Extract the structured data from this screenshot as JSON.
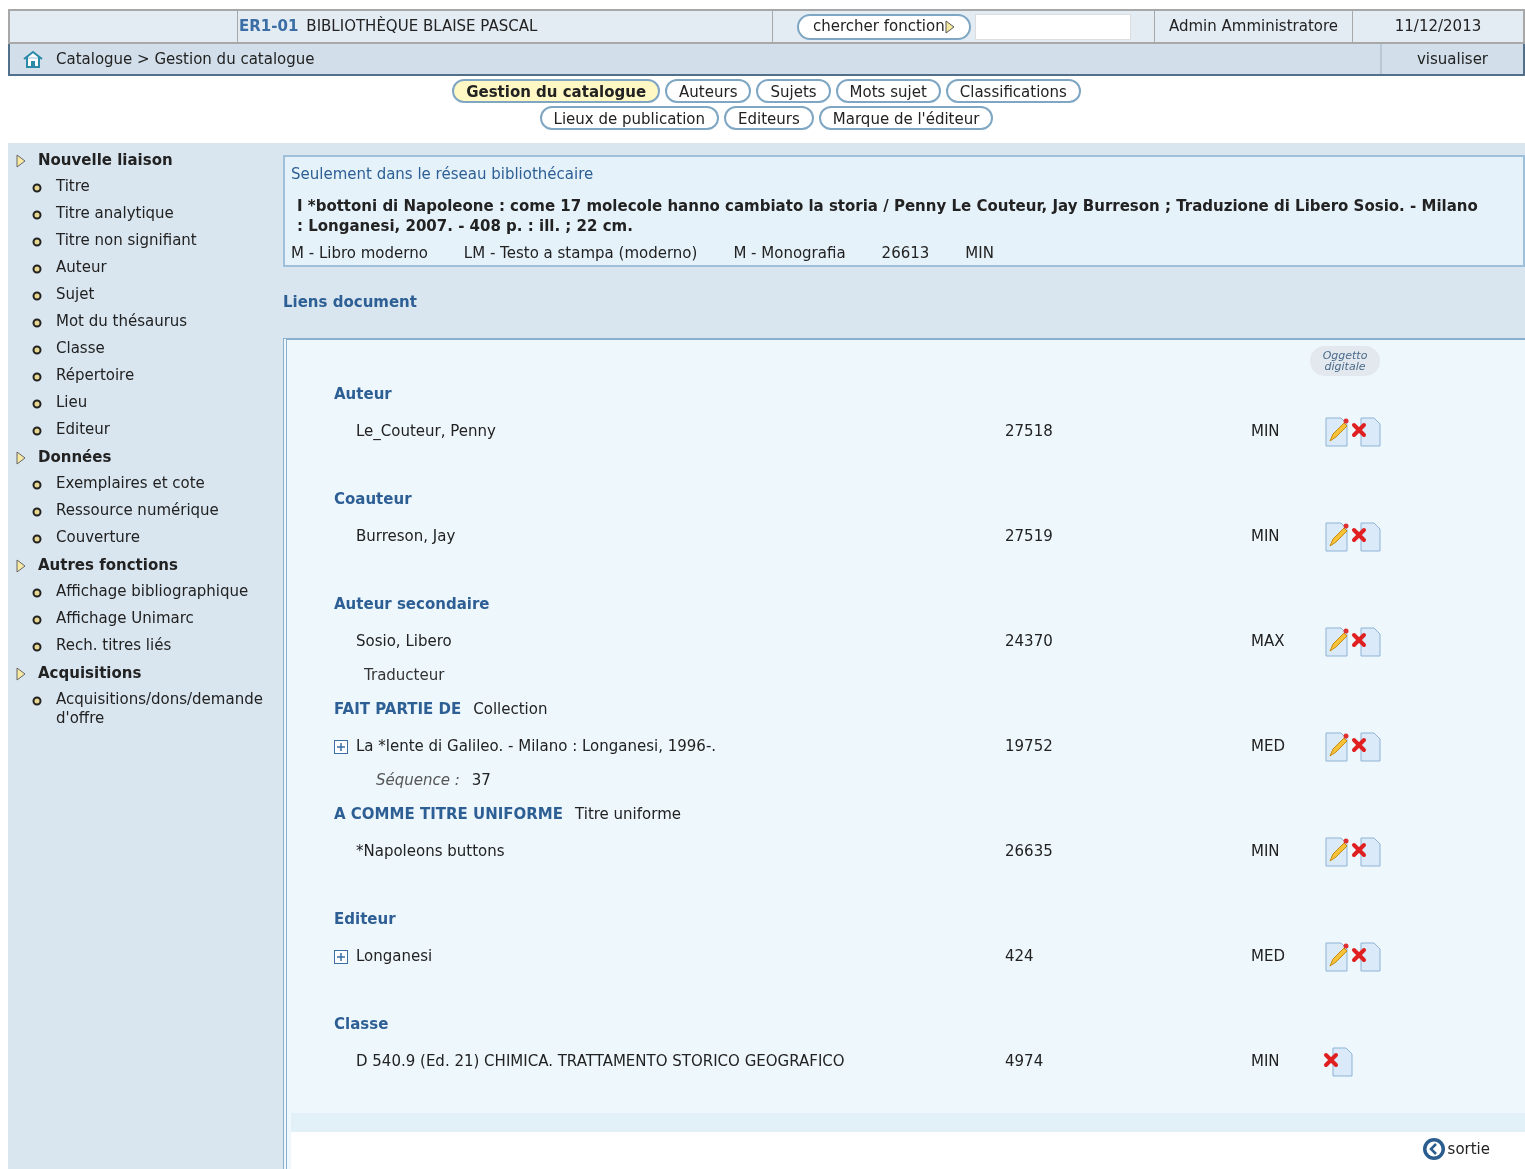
{
  "header": {
    "code": "ER1-01",
    "library": "BIBLIOTHÈQUE BLAISE PASCAL",
    "search_button": "chercher fonction",
    "user": "Admin Amministratore",
    "date": "11/12/2013"
  },
  "breadcrumb": {
    "path": "Catalogue > Gestion du catalogue",
    "view_link": "visualiser"
  },
  "tab_rows": [
    {
      "tabs": [
        {
          "label": "Gestion du catalogue",
          "selected": true
        },
        {
          "label": "Auteurs",
          "selected": false
        },
        {
          "label": "Sujets",
          "selected": false
        },
        {
          "label": "Mots sujet",
          "selected": false
        },
        {
          "label": "Classifications",
          "selected": false
        }
      ]
    },
    {
      "tabs": [
        {
          "label": "Lieux de publication",
          "selected": false
        },
        {
          "label": "Editeurs",
          "selected": false
        },
        {
          "label": "Marque de l'éditeur",
          "selected": false
        }
      ]
    }
  ],
  "sidebar": {
    "groups": [
      {
        "title": "Nouvelle liaison",
        "items": [
          "Titre",
          "Titre analytique",
          "Titre non signifiant",
          "Auteur",
          "Sujet",
          "Mot du thésaurus",
          "Classe",
          "Répertoire",
          "Lieu",
          "Editeur"
        ]
      },
      {
        "title": "Données",
        "items": [
          "Exemplaires et cote",
          "Ressource numérique",
          "Couverture"
        ]
      },
      {
        "title": "Autres fonctions",
        "items": [
          "Affichage bibliographique",
          "Affichage Unimarc",
          "Rech. titres liés"
        ]
      },
      {
        "title": "Acquisitions",
        "items": [
          "Acquisitions/dons/demande d'offre"
        ]
      }
    ]
  },
  "record": {
    "scope_note": "Seulement dans le réseau bibliothécaire",
    "title": "I *bottoni di Napoleone : come 17 molecole hanno cambiato la storia / Penny Le Couteur, Jay Burreson ; Traduzione di Libero Sosio. - Milano : Longanesi, 2007. - 408 p. : ill. ; 22 cm.",
    "details": [
      "M - Libro moderno",
      "LM - Testo a stampa (moderno)",
      "M - Monografia",
      "26613",
      "MIN"
    ]
  },
  "links": {
    "title": "Liens document",
    "digital_object_button": "Oggetto digitale",
    "sections": [
      {
        "heading": "Auteur",
        "entry": {
          "text": "Le_Couteur, Penny",
          "expandable": false,
          "number": "27518",
          "level": "MIN",
          "can_edit": true,
          "can_delete": true
        }
      },
      {
        "heading": "Coauteur",
        "entry": {
          "text": "Burreson, Jay",
          "expandable": false,
          "number": "27519",
          "level": "MIN",
          "can_edit": true,
          "can_delete": true
        }
      },
      {
        "heading": "Auteur secondaire",
        "entry": {
          "text": "Sosio, Libero",
          "expandable": false,
          "number": "24370",
          "level": "MAX",
          "can_edit": true,
          "can_delete": true
        },
        "role": "Traducteur"
      },
      {
        "heading": "FAIT PARTIE DE",
        "relation": "Collection",
        "entry": {
          "text": "La *lente di Galileo. - Milano : Longanesi, 1996-.",
          "expandable": true,
          "number": "19752",
          "level": "MED",
          "can_edit": true,
          "can_delete": true
        },
        "sequence": {
          "label": "Séquence :",
          "value": "37"
        }
      },
      {
        "heading": "A COMME TITRE UNIFORME",
        "relation": "Titre uniforme",
        "entry": {
          "text": "*Napoleons buttons",
          "expandable": false,
          "number": "26635",
          "level": "MIN",
          "can_edit": true,
          "can_delete": true
        }
      },
      {
        "heading": "Editeur",
        "entry": {
          "text": "Longanesi",
          "expandable": true,
          "number": "424",
          "level": "MED",
          "can_edit": true,
          "can_delete": true
        }
      },
      {
        "heading": "Classe",
        "entry": {
          "text": "D 540.9 (Ed. 21) CHIMICA. TRATTAMENTO STORICO GEOGRAFICO",
          "expandable": false,
          "number": "4974",
          "level": "MIN",
          "can_edit": false,
          "can_delete": true
        }
      }
    ]
  },
  "exit_link": "sortie"
}
